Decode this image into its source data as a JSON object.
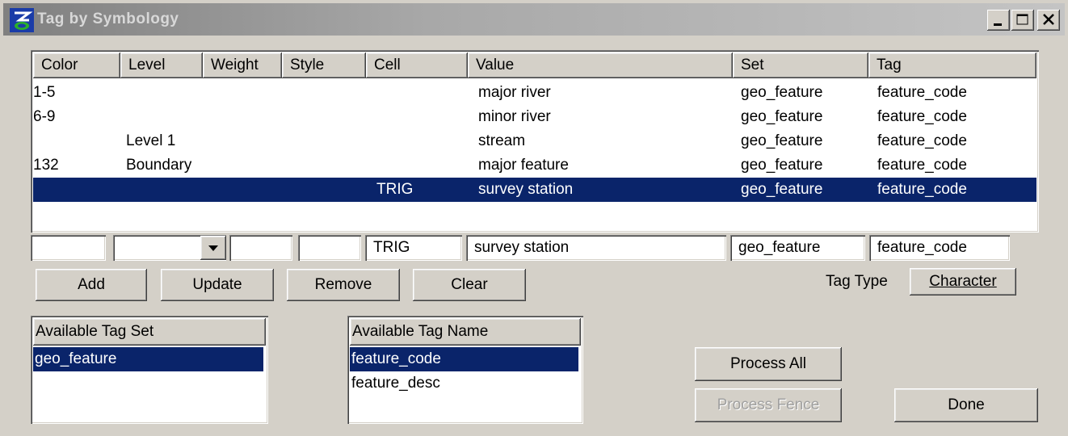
{
  "window": {
    "title": "Tag by Symbology",
    "icon": "app-logo-icon",
    "controls": [
      "minimize-icon",
      "maximize-icon",
      "close-icon"
    ]
  },
  "table": {
    "columns": [
      "Color",
      "Level",
      "Weight",
      "Style",
      "Cell",
      "Value",
      "Set",
      "Tag"
    ],
    "rows": [
      {
        "color": "1-5",
        "level": "",
        "weight": "",
        "style": "",
        "cell": "",
        "value": "major river",
        "set": "geo_feature",
        "tag": "feature_code"
      },
      {
        "color": "6-9",
        "level": "",
        "weight": "",
        "style": "",
        "cell": "",
        "value": "minor river",
        "set": "geo_feature",
        "tag": "feature_code"
      },
      {
        "color": "",
        "level": "Level 1",
        "weight": "",
        "style": "",
        "cell": "",
        "value": "stream",
        "set": "geo_feature",
        "tag": "feature_code"
      },
      {
        "color": "132",
        "level": "Boundary",
        "weight": "",
        "style": "",
        "cell": "",
        "value": "major feature",
        "set": "geo_feature",
        "tag": "feature_code"
      },
      {
        "color": "",
        "level": "",
        "weight": "",
        "style": "",
        "cell": "TRIG",
        "value": "survey station",
        "set": "geo_feature",
        "tag": "feature_code"
      }
    ],
    "selected_index": 4
  },
  "edit": {
    "color": "",
    "level": "",
    "weight": "",
    "style": "",
    "cell": "TRIG",
    "value": "survey station",
    "set": "geo_feature",
    "tag": "feature_code"
  },
  "buttons": {
    "add": "Add",
    "update": "Update",
    "remove": "Remove",
    "clear": "Clear",
    "process_all": "Process All",
    "process_fence": "Process Fence",
    "done": "Done"
  },
  "tag_type": {
    "label": "Tag Type",
    "value": "Character"
  },
  "tag_sets": {
    "header": "Available Tag Set",
    "items": [
      "geo_feature"
    ],
    "selected_index": 0
  },
  "tag_names": {
    "header": "Available Tag Name",
    "items": [
      "feature_code",
      "feature_desc"
    ],
    "selected_index": 0
  },
  "colors": {
    "selection": "#0a246a",
    "face": "#d4d0c8"
  }
}
